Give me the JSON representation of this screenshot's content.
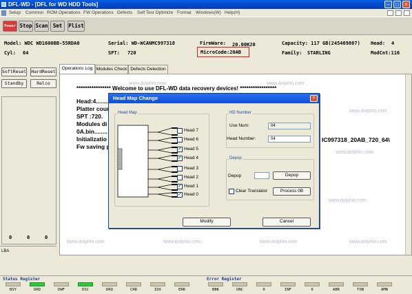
{
  "window": {
    "title": "DFL-WD - [DFL for WD HDD Tools]"
  },
  "menu": [
    "Setup",
    "Common",
    "ROM Operations",
    "FW Operations",
    "Defects",
    "Self Test Optimize",
    "Format",
    "Windows(W)",
    "Help(H)"
  ],
  "toolbar": {
    "power": "Power",
    "stop": "Stop",
    "scan": "Scan",
    "smt": "Smt",
    "plist": "Plist"
  },
  "info": {
    "model": "Model: WDC WD1600BB-55RDA0",
    "serial": "Serial: WD-WCANMC997318",
    "firmware_label": "FirmWare:",
    "firmware_value": "20.00K20",
    "capacity": "Capacity: 117 GB(245469807)",
    "head_label": "Head:",
    "head_value": "4",
    "cyl_label": "Cyl:",
    "cyl_value": "64",
    "spt_label": "SPT:",
    "spt_value": "720",
    "microcode": "MicroCode:20AB",
    "family_label": "Family:",
    "family_value": "STARLING",
    "modcnt": "ModCnt:116"
  },
  "left": {
    "softreset": "SoftReset",
    "hardreset": "HardReset",
    "standby": "Standby",
    "relco": "Relco",
    "counters": [
      "0",
      "0",
      "0"
    ],
    "lba_label": "LBA"
  },
  "tabs": [
    "Operations Log",
    "Modules Check",
    "Defects Detection"
  ],
  "log": {
    "welcome": "**************** Welcome to use DFL-WD data recovery devices! *****************",
    "lines": [
      "Head:4........",
      "Platter cour",
      "SPT :720.",
      "Modules di",
      "0A.bin........",
      "Initializatio",
      "Fw saving p"
    ],
    "tail": "IC997318_20AB_720_64\\"
  },
  "watermark": "www.dolphin.com",
  "dialog": {
    "title": "Head Map Change",
    "headmap_label": "Head Map",
    "heads": [
      {
        "label": "Head 7",
        "checked": false
      },
      {
        "label": "Head 6",
        "checked": false
      },
      {
        "label": "Head 5",
        "checked": true
      },
      {
        "label": "Head 4",
        "checked": true
      },
      {
        "label": "Head 3",
        "checked": false
      },
      {
        "label": "Head 2",
        "checked": false
      },
      {
        "label": "Head 1",
        "checked": true
      },
      {
        "label": "Head 0",
        "checked": true
      }
    ],
    "hd_number_label": "HD Number",
    "use_num_label": "Use Num:",
    "use_num_value": "04",
    "head_number_label": "Head Number:",
    "head_number_value": "04",
    "depop_group_label": "Depop",
    "depop_label": "Depop",
    "depop_button": "Depop",
    "clear_translator": "Clear Translator",
    "process_button": "Process 0B",
    "modify": "Modify",
    "cancel": "Cancel"
  },
  "status": {
    "status_register": "Status Register",
    "error_register": "Error Register",
    "status_bits": [
      {
        "label": "BSY",
        "on": false
      },
      {
        "label": "DRD",
        "on": true
      },
      {
        "label": "DWF",
        "on": false
      },
      {
        "label": "DSC",
        "on": true
      },
      {
        "label": "DRQ",
        "on": false
      },
      {
        "label": "CRR",
        "on": false
      },
      {
        "label": "IDX",
        "on": false
      },
      {
        "label": "ERR",
        "on": false
      }
    ],
    "error_bits": [
      {
        "label": "BBK",
        "on": false
      },
      {
        "label": "UNC",
        "on": false
      },
      {
        "label": "0",
        "on": false
      },
      {
        "label": "INF",
        "on": false
      },
      {
        "label": "0",
        "on": false
      },
      {
        "label": "ABR",
        "on": false
      },
      {
        "label": "TON",
        "on": false
      },
      {
        "label": "AMN",
        "on": false
      }
    ]
  }
}
